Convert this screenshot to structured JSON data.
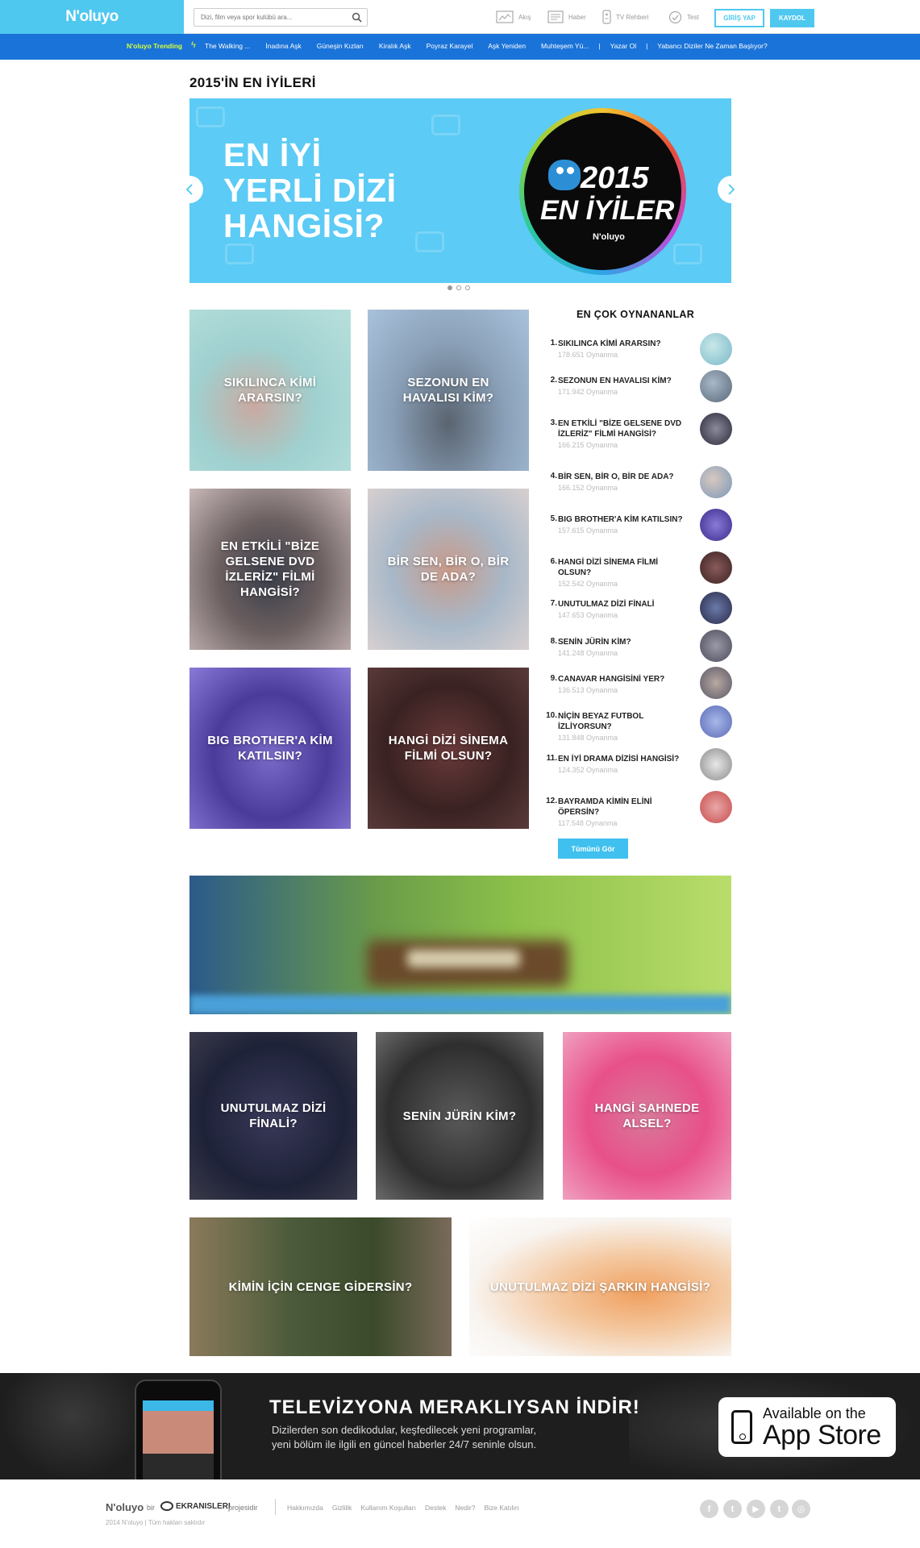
{
  "header": {
    "logo": "N'oluyo",
    "search_placeholder": "Dizi, film veya spor kulübü ara...",
    "nav": [
      {
        "label": "Akış",
        "icon": "feed-icon"
      },
      {
        "label": "Haber",
        "icon": "news-icon"
      },
      {
        "label": "TV Rehberi",
        "icon": "tv-guide-icon"
      },
      {
        "label": "Test",
        "icon": "test-check-icon"
      }
    ],
    "login_label": "GİRİŞ YAP",
    "signup_label": "KAYDOL"
  },
  "trending": {
    "label": "N'oluyo Trending",
    "items": [
      "The Walking ...",
      "İnadına Aşk",
      "Güneşin Kızları",
      "Kiralık Aşk",
      "Poyraz Karayel",
      "Aşk Yeniden",
      "Muhteşem Yü...",
      "Yazar Ol",
      "Yabancı Diziler Ne Zaman Başlıyor?"
    ]
  },
  "page_title": "2015'İN EN İYİLERİ",
  "hero": {
    "lines": [
      "EN İYİ",
      "YERLİ DİZİ",
      "HANGİSİ?"
    ],
    "badge_year": "2015",
    "badge_text": "EN İYİLER",
    "badge_logo": "N'oluyo",
    "active_slide": 1,
    "slide_count": 3
  },
  "quizzes": [
    {
      "title": "SIKILINCA KİMİ ARARSIN?"
    },
    {
      "title": "SEZONUN EN HAVALISI KİM?"
    },
    {
      "title": "EN ETKİLİ \"BİZE GELSENE DVD İZLERİZ\" FİLMİ HANGİSİ?"
    },
    {
      "title": "BİR SEN, BİR O, BİR DE ADA?"
    },
    {
      "title": "BIG BROTHER'A KİM KATILSIN?"
    },
    {
      "title": "HANGİ DİZİ SİNEMA FİLMİ OLSUN?"
    },
    {
      "title": "UNUTULMAZ DİZİ FİNALİ?"
    },
    {
      "title": "SENİN JÜRİN KİM?"
    },
    {
      "title": "HANGİ SAHNEDE ALSEL?"
    },
    {
      "title": "KİMİN İÇİN CENGE GİDERSİN?"
    },
    {
      "title": "UNUTULMAZ DİZİ ŞARKIN HANGİSİ?"
    }
  ],
  "most_played": {
    "title": "EN ÇOK OYNANANLAR",
    "items": [
      {
        "rank": "1.",
        "name": "SIKILINCA KİMİ ARARSIN?",
        "plays": "178.651 Oynanma"
      },
      {
        "rank": "2.",
        "name": "SEZONUN EN HAVALISI KİM?",
        "plays": "171.942 Oynanma"
      },
      {
        "rank": "3.",
        "name": "EN ETKİLİ \"BİZE GELSENE DVD İZLERİZ\" FİLMİ HANGİSİ?",
        "plays": "166.215 Oynanma"
      },
      {
        "rank": "4.",
        "name": "BİR SEN, BİR O, BİR DE ADA?",
        "plays": "166.152 Oynanma"
      },
      {
        "rank": "5.",
        "name": "BIG BROTHER'A KİM KATILSIN?",
        "plays": "157.615 Oynanma"
      },
      {
        "rank": "6.",
        "name": "HANGİ DİZİ SİNEMA FİLMİ OLSUN?",
        "plays": "152.542 Oynanma"
      },
      {
        "rank": "7.",
        "name": "UNUTULMAZ DİZİ FİNALİ",
        "plays": "147.653 Oynanma"
      },
      {
        "rank": "8.",
        "name": "SENİN JÜRİN KİM?",
        "plays": "141.248 Oynanma"
      },
      {
        "rank": "9.",
        "name": "CANAVAR HANGİSİNİ YER?",
        "plays": "136.513 Oynanma"
      },
      {
        "rank": "10.",
        "name": "NİÇİN BEYAZ FUTBOL İZLİYORSUN?",
        "plays": "131.848 Oynanma"
      },
      {
        "rank": "11.",
        "name": "EN İYİ DRAMA DİZİSİ HANGİSİ?",
        "plays": "124.352 Oynanma"
      },
      {
        "rank": "12.",
        "name": "BAYRAMDA KİMİN ELİNİ ÖPERSİN?",
        "plays": "117.548 Oynanma"
      }
    ],
    "see_all": "Tümünü Gör"
  },
  "promo": {
    "title": "TELEVİZYONA MERAKLIYSAN İNDİR!",
    "desc_line1": "Dizilerden son dedikodular, keşfedilecek yeni programlar,",
    "desc_line2": "yeni bölüm ile ilgili en güncel haberler 24/7 seninle olsun.",
    "appstore_line1": "Available on the",
    "appstore_line2": "App Store"
  },
  "footer": {
    "logo": "N'oluyo",
    "bir": "bir",
    "ekran": "EKRANISLERI",
    "proje": "projesidir",
    "links": [
      "Hakkımızda",
      "Gizlilik",
      "Kullanım Koşulları",
      "Destek",
      "Nedir?",
      "Bize Katılın"
    ],
    "copyright": "2014 N'oluyo | Tüm hakları saklıdır",
    "social": [
      {
        "icon": "facebook-icon",
        "glyph": "f"
      },
      {
        "icon": "twitter-icon",
        "glyph": "t"
      },
      {
        "icon": "youtube-icon",
        "glyph": "▶"
      },
      {
        "icon": "tumblr-icon",
        "glyph": "t"
      },
      {
        "icon": "instagram-icon",
        "glyph": "◎"
      }
    ]
  },
  "colors": {
    "brand": "#4fc8f0",
    "trend_bar": "#1a73d8",
    "trend_label": "#d8ff3a"
  }
}
